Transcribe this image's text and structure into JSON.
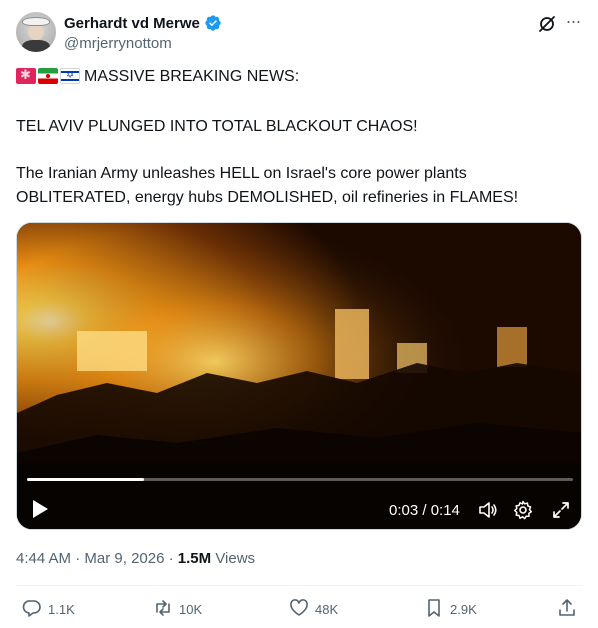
{
  "author": {
    "display_name": "Gerhardt vd Merwe",
    "handle": "@mrjerrynottom",
    "verified": true
  },
  "header_icons": [
    "grok-icon",
    "more-icon"
  ],
  "more_glyph": "···",
  "post": {
    "line1_flags": [
      "siren-emoji",
      "iran-flag",
      "israel-flag"
    ],
    "line1": "MASSIVE BREAKING NEWS:",
    "line2": "TEL AVIV PLUNGED INTO TOTAL BLACKOUT CHAOS!",
    "line3": "The Iranian Army unleashes HELL on Israel's core power plants",
    "line4": "OBLITERATED, energy hubs DEMOLISHED, oil refineries in FLAMES!"
  },
  "video": {
    "current_time": "0:03",
    "duration": "0:14",
    "timecode": "0:03 / 0:14",
    "progress_fraction": 0.2143
  },
  "meta": {
    "time": "4:44 AM",
    "date": "Mar 9, 2026",
    "views_count": "1.5M",
    "views_label": "Views"
  },
  "actions": {
    "replies": "1.1K",
    "reposts": "10K",
    "likes": "48K",
    "bookmarks": "2.9K"
  },
  "colors": {
    "verified_blue": "#1d9bf0",
    "text_primary": "#0f1419",
    "text_secondary": "#536471"
  }
}
